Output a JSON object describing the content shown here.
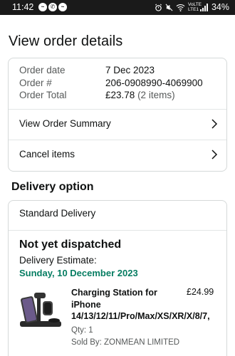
{
  "status_bar": {
    "time": "11:42",
    "app_icons": [
      "messenger-icon",
      "whatsapp-icon",
      "messenger-icon"
    ],
    "lte_label": "VoLTE LTE1",
    "battery_percent": "34%"
  },
  "page": {
    "title": "View order details"
  },
  "order_info": {
    "date_label": "Order date",
    "date_value": "7 Dec 2023",
    "number_label": "Order #",
    "number_value": "206-0908990-4069900",
    "total_label": "Order Total",
    "total_value": "£23.78",
    "total_items": "(2 items)"
  },
  "links": {
    "summary": "View Order Summary",
    "cancel": "Cancel items"
  },
  "delivery": {
    "section_title": "Delivery option",
    "option": "Standard Delivery",
    "status": "Not yet dispatched",
    "estimate_label": "Delivery Estimate:",
    "estimate_date": "Sunday, 10 December 2023",
    "estimate_color": "#067d62"
  },
  "product": {
    "title": "Charging Station for iPhone",
    "models": "14/13/12/11/Pro/Max/XS/XR/X/8/7,",
    "price": "£24.99",
    "qty": "Qty: 1",
    "seller": "Sold By: ZONMEAN LIMITED"
  }
}
